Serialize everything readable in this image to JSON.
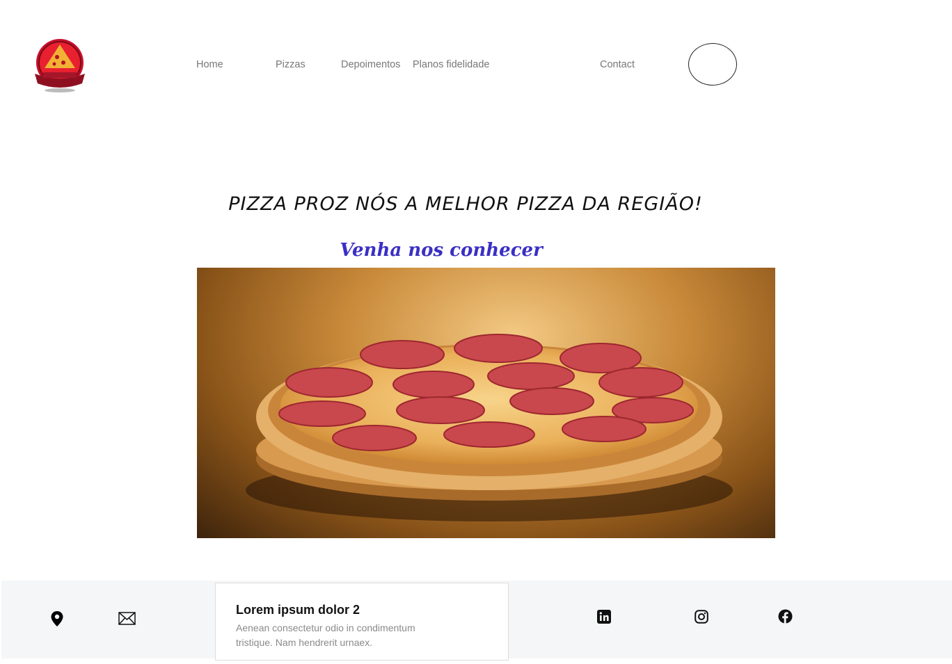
{
  "header": {
    "logo_alt": "Pizzaria Proz Nós",
    "nav": {
      "home": "Home",
      "pizzas": "Pizzas",
      "depoimentos": "Depoimentos",
      "planos": "Planos fidelidade",
      "contact": "Contact"
    }
  },
  "hero": {
    "title": "PIZZA PROZ NÓS A MELHOR PIZZA DA REGIÃO!",
    "subtitle": "Venha nos conhecer",
    "image_alt": "Pepperoni pizza"
  },
  "footer": {
    "icons": [
      "location-pin-icon",
      "email-icon",
      "linkedin-icon",
      "instagram-icon",
      "facebook-icon"
    ],
    "card": {
      "title": "Lorem ipsum dolor 2",
      "text": "Aenean consectetur odio in condimentum tristique. Nam hendrerit urnaex."
    }
  },
  "colors": {
    "subtitle": "#3a2fc4",
    "nav_text": "#777777",
    "footer_bg": "#f5f6f8"
  }
}
